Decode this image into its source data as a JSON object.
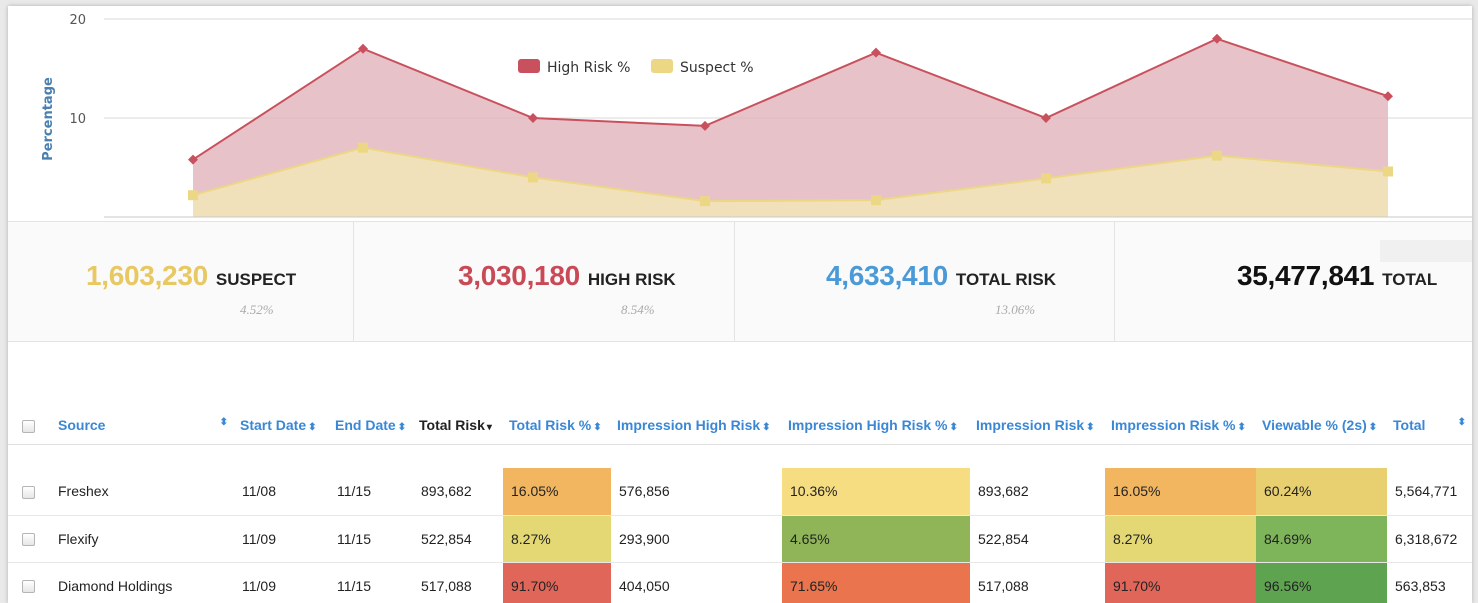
{
  "chart_data": {
    "type": "area",
    "title": "",
    "xlabel": "",
    "ylabel": "Percentage",
    "ylim": [
      0,
      20
    ],
    "y_ticks": [
      "10",
      "20"
    ],
    "grid": true,
    "legend_position": "top-center",
    "series": [
      {
        "name": "High Risk %",
        "color": "#c9515e",
        "fill": "#e3b9bf",
        "values": [
          5.8,
          17.0,
          10.0,
          9.2,
          16.6,
          10.0,
          18.0,
          12.2
        ]
      },
      {
        "name": "Suspect %",
        "color": "#ecd785",
        "fill": "#f2e4b9",
        "values": [
          2.2,
          7.0,
          4.0,
          1.6,
          1.7,
          3.9,
          6.2,
          4.6
        ]
      }
    ]
  },
  "kpis": [
    {
      "value": "1,603,230",
      "label": "SUSPECT",
      "pct": "4.52%",
      "color": "#e8c862"
    },
    {
      "value": "3,030,180",
      "label": "HIGH RISK",
      "pct": "8.54%",
      "color": "#c94a56"
    },
    {
      "value": "4,633,410",
      "label": "TOTAL RISK",
      "pct": "13.06%",
      "color": "#4b9ad8"
    },
    {
      "value": "35,477,841",
      "label": "TOTAL",
      "pct": "",
      "color": "#111111"
    }
  ],
  "table": {
    "headers": {
      "source": "Source",
      "start_date": "Start Date",
      "end_date": "End Date",
      "total_risk": "Total Risk",
      "total_risk_pct": "Total Risk %",
      "impression_high_risk": "Impression High Risk",
      "impression_high_risk_pct": "Impression High Risk %",
      "impression_risk": "Impression Risk",
      "impression_risk_pct": "Impression Risk %",
      "viewable_pct": "Viewable % (2s)",
      "total": "Total"
    },
    "rows": [
      {
        "source": "Freshex",
        "start_date": "11/08",
        "end_date": "11/15",
        "total_risk": "893,682",
        "total_risk_pct": "16.05%",
        "impression_high_risk": "576,856",
        "impression_high_risk_pct": "10.36%",
        "impression_risk": "893,682",
        "impression_risk_pct": "16.05%",
        "viewable_pct": "60.24%",
        "total": "5,564,771"
      },
      {
        "source": "Flexify",
        "start_date": "11/09",
        "end_date": "11/15",
        "total_risk": "522,854",
        "total_risk_pct": "8.27%",
        "impression_high_risk": "293,900",
        "impression_high_risk_pct": "4.65%",
        "impression_risk": "522,854",
        "impression_risk_pct": "8.27%",
        "viewable_pct": "84.69%",
        "total": "6,318,672"
      },
      {
        "source": "Diamond Holdings",
        "start_date": "11/09",
        "end_date": "11/15",
        "total_risk": "517,088",
        "total_risk_pct": "91.70%",
        "impression_high_risk": "404,050",
        "impression_high_risk_pct": "71.65%",
        "impression_risk": "517,088",
        "impression_risk_pct": "91.70%",
        "viewable_pct": "96.56%",
        "total": "563,853"
      }
    ],
    "cell_colors": [
      {
        "total_risk_pct": "#f2b661",
        "impression_high_risk_pct": "#f7dd82",
        "impression_risk_pct": "#f2b661",
        "viewable_pct": "#e8d070"
      },
      {
        "total_risk_pct": "#e3d874",
        "impression_high_risk_pct": "#8fb558",
        "impression_risk_pct": "#e3d874",
        "viewable_pct": "#7eb55b"
      },
      {
        "total_risk_pct": "#e0665a",
        "impression_high_risk_pct": "#e9744d",
        "impression_risk_pct": "#e0665a",
        "viewable_pct": "#5ea450"
      }
    ]
  }
}
